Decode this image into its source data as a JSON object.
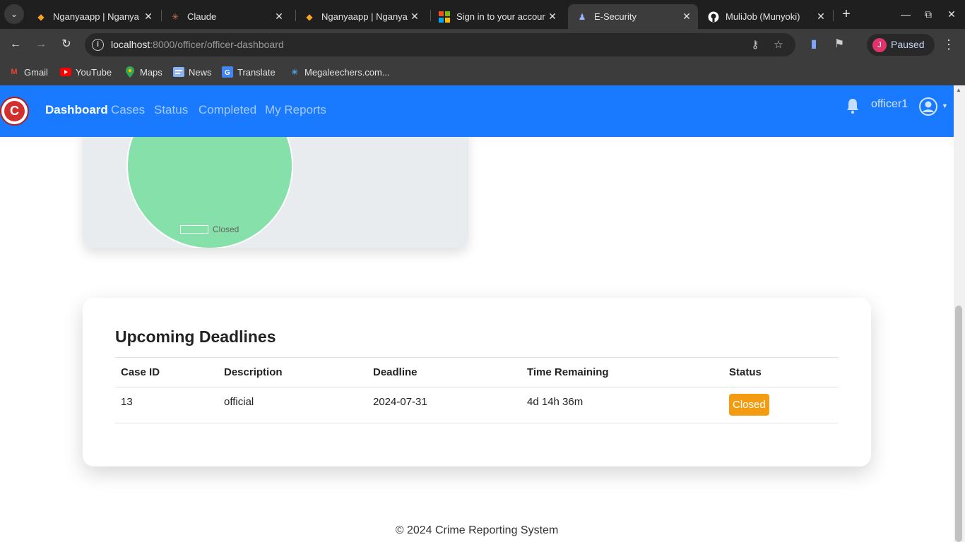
{
  "browser": {
    "tabs": [
      {
        "title": "Nganyaapp | Nganya",
        "active": false
      },
      {
        "title": "Claude",
        "active": false
      },
      {
        "title": "Nganyaapp | Nganya",
        "active": false
      },
      {
        "title": "Sign in to your account",
        "active": false
      },
      {
        "title": "E-Security",
        "active": true
      },
      {
        "title": "MuliJob (Munyoki)",
        "active": false
      }
    ],
    "url_host": "localhost",
    "url_rest": ":8000/officer/officer-dashboard",
    "profile_initial": "J",
    "profile_status": "Paused",
    "bookmarks": [
      {
        "label": "Gmail",
        "icon": "gmail-icon"
      },
      {
        "label": "YouTube",
        "icon": "youtube-icon"
      },
      {
        "label": "Maps",
        "icon": "maps-icon"
      },
      {
        "label": "News",
        "icon": "news-icon"
      },
      {
        "label": "Translate",
        "icon": "translate-icon"
      },
      {
        "label": "Megaleechers.com...",
        "icon": "megaleechers-icon"
      }
    ]
  },
  "navbar": {
    "logo_letter": "C",
    "links": [
      {
        "label": "Dashboard",
        "active": true
      },
      {
        "label": "Cases",
        "active": false
      },
      {
        "label": "Status",
        "active": false
      },
      {
        "label": "Completed",
        "active": false
      },
      {
        "label": "My Reports",
        "active": false
      }
    ],
    "username": "officer1"
  },
  "chart_data": {
    "type": "pie",
    "categories": [
      "Closed"
    ],
    "values": [
      1
    ],
    "colors": [
      "#86e0a9"
    ],
    "legend": "bottom"
  },
  "deadlines": {
    "title": "Upcoming Deadlines",
    "columns": [
      "Case ID",
      "Description",
      "Deadline",
      "Time Remaining",
      "Status"
    ],
    "rows": [
      {
        "case_id": "13",
        "description": "official",
        "deadline": "2024-07-31",
        "time_remaining": "4d 14h 36m",
        "status": "Closed"
      }
    ]
  },
  "colors": {
    "navbar": "#1a7aff",
    "status_closed": "#f39c12",
    "pie_closed": "#86e0a9"
  },
  "footer": "© 2024 Crime Reporting System"
}
